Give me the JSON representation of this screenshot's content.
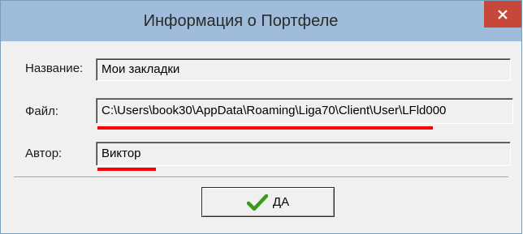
{
  "window": {
    "title": "Информация о Портфеле",
    "close_glyph": "×"
  },
  "fields": {
    "name": {
      "label": "Название:",
      "value": "Мои закладки"
    },
    "file": {
      "label": "Файл:",
      "value": "C:\\Users\\book30\\AppData\\Roaming\\Liga70\\Client\\User\\LFld000"
    },
    "author": {
      "label": "Автор:",
      "value": "Виктор"
    }
  },
  "ok_button": {
    "label": "ДА",
    "icon": "checkmark-icon"
  },
  "colors": {
    "titlebar": "#9fbcda",
    "close": "#c7473b",
    "underline": "#ff0000",
    "check": "#3a9a1c"
  }
}
